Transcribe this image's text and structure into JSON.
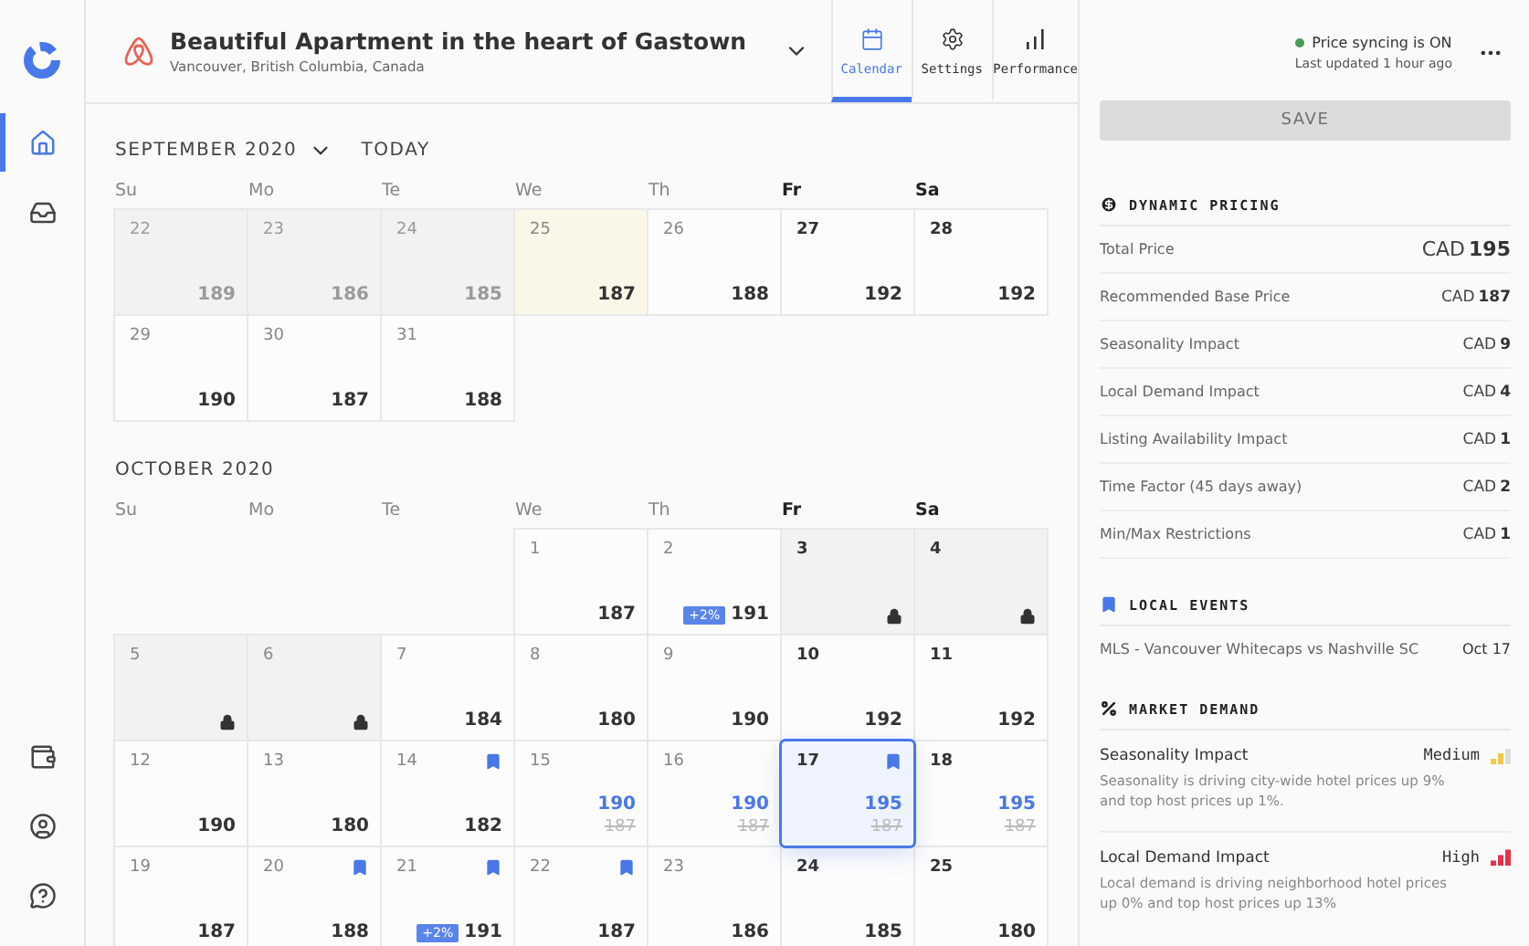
{
  "sidebar": {
    "items": [
      {
        "kind": "home",
        "selected": true
      },
      {
        "kind": "inbox",
        "selected": false
      }
    ],
    "bottom_items": [
      {
        "kind": "wallet",
        "selected": false
      },
      {
        "kind": "account",
        "selected": false
      },
      {
        "kind": "help",
        "selected": false
      }
    ]
  },
  "listing": {
    "title": "Beautiful Apartment in the heart of Gastown",
    "location": "Vancouver, British Columbia, Canada"
  },
  "tabs": [
    {
      "kind": "calendar",
      "label": "Calendar",
      "selected": true
    },
    {
      "kind": "settings",
      "label": "Settings",
      "selected": false
    },
    {
      "kind": "performance",
      "label": "Performance",
      "selected": false
    }
  ],
  "sync": {
    "status": "Price syncing is ON",
    "on": true,
    "updated": "Last updated 1 hour ago"
  },
  "calendar": {
    "today_label": "TODAY",
    "months": [
      {
        "title": "SEPTEMBER 2020",
        "dropdown": true,
        "day_headers": [
          {
            "label": "Su",
            "weekend": false
          },
          {
            "label": "Mo",
            "weekend": false
          },
          {
            "label": "Te",
            "weekend": false
          },
          {
            "label": "We",
            "weekend": false
          },
          {
            "label": "Th",
            "weekend": false
          },
          {
            "label": "Fr",
            "weekend": true
          },
          {
            "label": "Sa",
            "weekend": true
          }
        ],
        "weeks": [
          [
            {
              "day": "22",
              "price": "189",
              "kind": "past",
              "event": false,
              "selected": false
            },
            {
              "day": "23",
              "price": "186",
              "kind": "past",
              "event": false,
              "selected": false
            },
            {
              "day": "24",
              "price": "185",
              "kind": "past",
              "event": false,
              "selected": false
            },
            {
              "day": "25",
              "price": "187",
              "kind": "today",
              "event": false,
              "selected": false
            },
            {
              "day": "26",
              "price": "188",
              "kind": "normal",
              "event": false,
              "selected": false
            },
            {
              "day": "27",
              "price": "192",
              "kind": "normal",
              "event": false,
              "selected": false
            },
            {
              "day": "28",
              "price": "192",
              "kind": "normal",
              "event": false,
              "selected": false
            }
          ],
          [
            {
              "day": "29",
              "price": "190",
              "kind": "normal",
              "event": false,
              "selected": false
            },
            {
              "day": "30",
              "price": "187",
              "kind": "normal",
              "event": false,
              "selected": false
            },
            {
              "day": "31",
              "price": "188",
              "kind": "normal",
              "event": false,
              "selected": false
            },
            {
              "kind": "empty"
            },
            {
              "kind": "empty"
            },
            {
              "kind": "empty"
            },
            {
              "kind": "empty"
            }
          ]
        ]
      },
      {
        "title": "OCTOBER 2020",
        "day_headers": [
          {
            "label": "Su",
            "weekend": false
          },
          {
            "label": "Mo",
            "weekend": false
          },
          {
            "label": "Te",
            "weekend": false
          },
          {
            "label": "We",
            "weekend": false
          },
          {
            "label": "Th",
            "weekend": false
          },
          {
            "label": "Fr",
            "weekend": true
          },
          {
            "label": "Sa",
            "weekend": true
          }
        ],
        "weeks": [
          [
            {
              "kind": "empty"
            },
            {
              "kind": "empty"
            },
            {
              "kind": "empty"
            },
            {
              "day": "1",
              "price": "187",
              "kind": "normal",
              "event": false,
              "selected": false
            },
            {
              "day": "2",
              "price": "191",
              "badge": "+2%",
              "kind": "normal",
              "event": false,
              "selected": false
            },
            {
              "day": "3",
              "kind": "blocked",
              "event": false,
              "selected": false
            },
            {
              "day": "4",
              "kind": "blocked",
              "event": false,
              "selected": false
            }
          ],
          [
            {
              "day": "5",
              "kind": "blocked",
              "event": false,
              "selected": false
            },
            {
              "day": "6",
              "kind": "blocked",
              "event": false,
              "selected": false
            },
            {
              "day": "7",
              "price": "184",
              "kind": "normal",
              "event": false,
              "selected": false
            },
            {
              "day": "8",
              "price": "180",
              "kind": "normal",
              "event": false,
              "selected": false
            },
            {
              "day": "9",
              "price": "190",
              "kind": "normal",
              "event": false,
              "selected": false
            },
            {
              "day": "10",
              "price": "192",
              "kind": "normal",
              "event": false,
              "selected": false
            },
            {
              "day": "11",
              "price": "192",
              "kind": "normal",
              "event": false,
              "selected": false
            }
          ],
          [
            {
              "day": "12",
              "price": "190",
              "kind": "normal",
              "event": false,
              "selected": false
            },
            {
              "day": "13",
              "price": "180",
              "kind": "normal",
              "event": false,
              "selected": false
            },
            {
              "day": "14",
              "price": "182",
              "kind": "normal",
              "event": true,
              "selected": false
            },
            {
              "day": "15",
              "price": "190",
              "old_price": "187",
              "kind": "normal",
              "event": false,
              "selected": false
            },
            {
              "day": "16",
              "price": "190",
              "old_price": "187",
              "kind": "normal",
              "event": false,
              "selected": false
            },
            {
              "day": "17",
              "price": "195",
              "old_price": "187",
              "kind": "normal",
              "event": true,
              "selected": true
            },
            {
              "day": "18",
              "price": "195",
              "old_price": "187",
              "kind": "normal",
              "event": false,
              "selected": false
            }
          ],
          [
            {
              "day": "19",
              "price": "187",
              "kind": "normal",
              "event": false,
              "selected": false
            },
            {
              "day": "20",
              "price": "188",
              "kind": "normal",
              "event": true,
              "selected": false
            },
            {
              "day": "21",
              "price": "191",
              "badge": "+2%",
              "kind": "normal",
              "event": true,
              "selected": false
            },
            {
              "day": "22",
              "price": "187",
              "kind": "normal",
              "event": true,
              "selected": false
            },
            {
              "day": "23",
              "price": "186",
              "kind": "normal",
              "event": false,
              "selected": false
            },
            {
              "day": "24",
              "price": "185",
              "kind": "normal",
              "event": false,
              "selected": false
            },
            {
              "day": "25",
              "price": "180",
              "kind": "normal",
              "event": false,
              "selected": false
            }
          ]
        ]
      }
    ]
  },
  "save_button": {
    "label": "SAVE",
    "disabled": true
  },
  "dynamic_pricing": {
    "title": "DYNAMIC PRICING",
    "rows": [
      {
        "label": "Total Price",
        "currency": "CAD",
        "amount": "195",
        "kind": "total"
      },
      {
        "label": "Recommended Base Price",
        "currency": "CAD",
        "amount": "187",
        "kind": "line"
      },
      {
        "label": "Seasonality Impact",
        "currency": "CAD",
        "amount": "9",
        "kind": "line"
      },
      {
        "label": "Local Demand Impact",
        "currency": "CAD",
        "amount": "4",
        "kind": "line"
      },
      {
        "label": "Listing Availability Impact",
        "currency": "CAD",
        "amount": "1",
        "kind": "line"
      },
      {
        "label": "Time Factor (45 days away)",
        "currency": "CAD",
        "amount": "2",
        "kind": "line"
      },
      {
        "label": "Min/Max Restrictions",
        "currency": "CAD",
        "amount": "1",
        "kind": "line"
      }
    ]
  },
  "local_events": {
    "title": "LOCAL EVENTS",
    "events": [
      {
        "name": "MLS - Vancouver Whitecaps vs Nashville SC",
        "date": "Oct 17"
      }
    ]
  },
  "market_demand": {
    "title": "MARKET DEMAND",
    "items": [
      {
        "label": "Seasonality Impact",
        "rating": "Medium",
        "level": 0.67,
        "color": "#f2c94c",
        "description": "Seasonality is driving city-wide hotel prices up 9% and top host prices up 1%."
      },
      {
        "label": "Local Demand Impact",
        "rating": "High",
        "level": 1,
        "color": "#e0334f",
        "description": "Local demand is driving neighborhood hotel prices up 0% and top host prices up 13%"
      }
    ]
  }
}
